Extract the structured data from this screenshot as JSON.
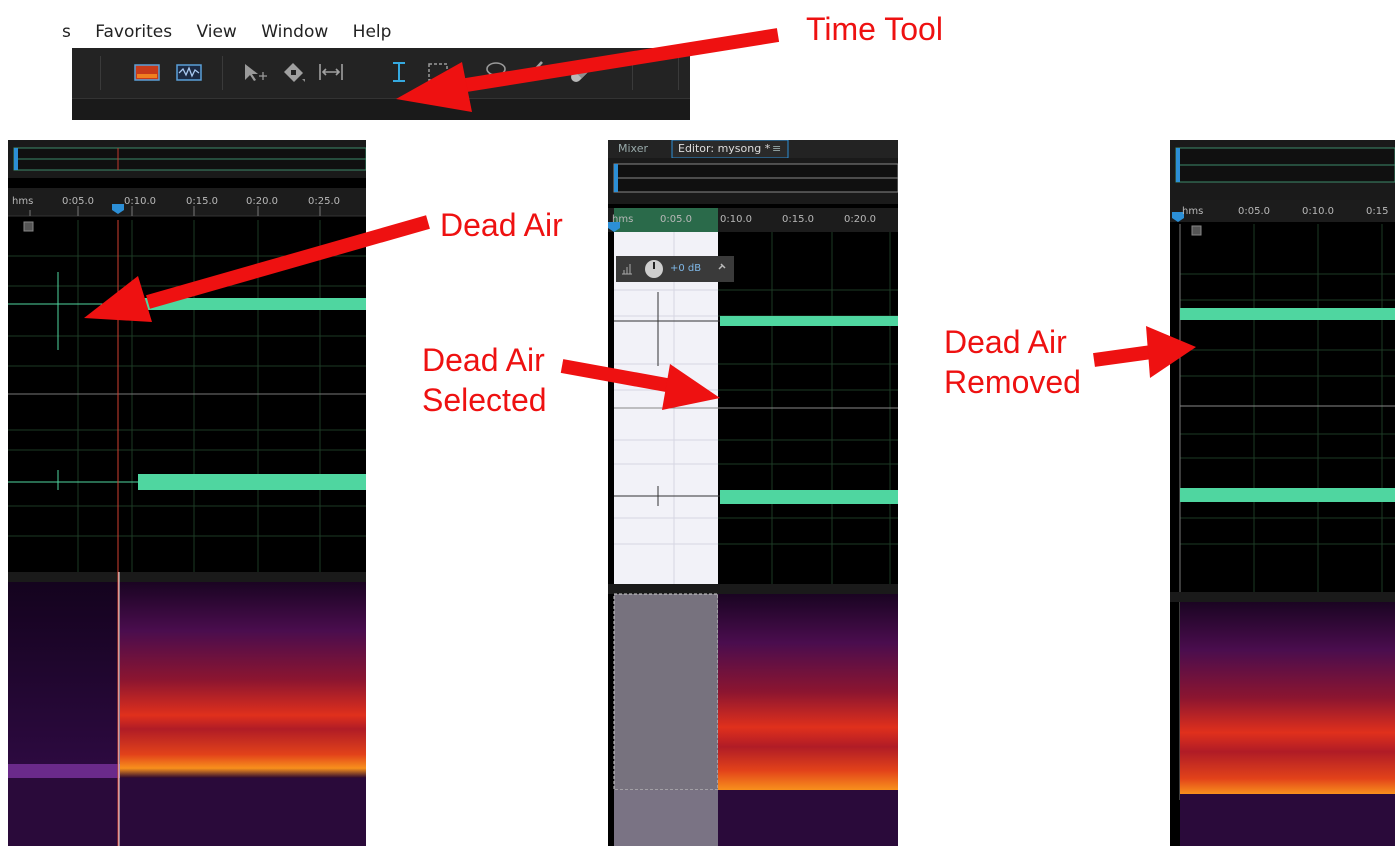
{
  "menu": [
    "s",
    "Favorites",
    "View",
    "Window",
    "Help"
  ],
  "toolbar": {
    "tools": [
      "spectral-view-icon",
      "waveform-view-icon",
      "move-tool-icon",
      "razor-tool-icon",
      "slip-tool-icon",
      "time-selection-tool-icon",
      "marquee-tool-icon",
      "lasso-tool-icon",
      "brush-tool-icon",
      "healing-tool-icon"
    ],
    "accent": "#35a9e0"
  },
  "annotations": {
    "time_tool": "Time Tool",
    "dead_air": "Dead Air",
    "dead_air_selected_1": "Dead Air",
    "dead_air_selected_2": "Selected",
    "dead_air_removed_1": "Dead Air",
    "dead_air_removed_2": "Removed",
    "arrow_color": "#ee1111"
  },
  "panel_left": {
    "ruler_unit": "hms",
    "ticks": [
      "0:05.0",
      "0:10.0",
      "0:15.0",
      "0:20.0",
      "0:25.0"
    ]
  },
  "panel_middle": {
    "tabs": [
      "Mixer",
      "Editor: mysong *"
    ],
    "tab_menu_icon": "≡",
    "ruler_unit": "hms",
    "ticks": [
      "0:05.0",
      "0:10.0",
      "0:15.0",
      "0:20.0"
    ],
    "gain_value": "+0 dB"
  },
  "panel_right": {
    "ruler_unit": "hms",
    "ticks": [
      "0:05.0",
      "0:10.0",
      "0:15"
    ]
  },
  "colors": {
    "waveform": "#4fd6a0",
    "playhead": "#2c8fd6",
    "selection": "#f2f2f8"
  }
}
